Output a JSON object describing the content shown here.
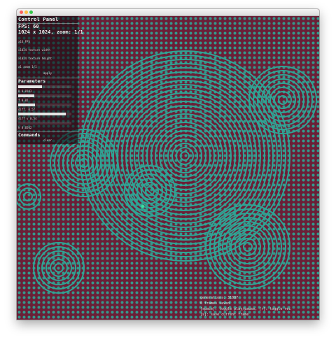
{
  "panel": {
    "title": "Control Panel",
    "fps": "FPS: 60",
    "dims": "1024 x 1024, zoom: 1/1",
    "fields": [
      "x16 FPS",
      "x1024 texture width",
      "x1024 texture height",
      "x1 zoom 1/1"
    ],
    "apply_label": "apply"
  },
  "parameters": {
    "title": "Parameters",
    "sliders": [
      {
        "label": "D 0.0103",
        "fill": 0.45
      },
      {
        "label": "f 0.02",
        "fill": 0.3
      },
      {
        "label": "diff. 0.57",
        "fill": 0.32
      },
      {
        "label": "diff v 0.54",
        "fill": 0.9
      },
      {
        "label": "k 0.0562",
        "fill": 0.0
      }
    ]
  },
  "commands": {
    "title": "Commands",
    "clear_label": "clear"
  },
  "status": {
    "lines": [
      "generations: 31087",
      "0 frames saved",
      "[space]: toggle play/pause, [r]: toggle rec",
      "[s]: save current frame"
    ]
  },
  "colors": {
    "background": "#6b1f37",
    "pattern": "#2fa595",
    "cursor": "#3ddc9f"
  }
}
